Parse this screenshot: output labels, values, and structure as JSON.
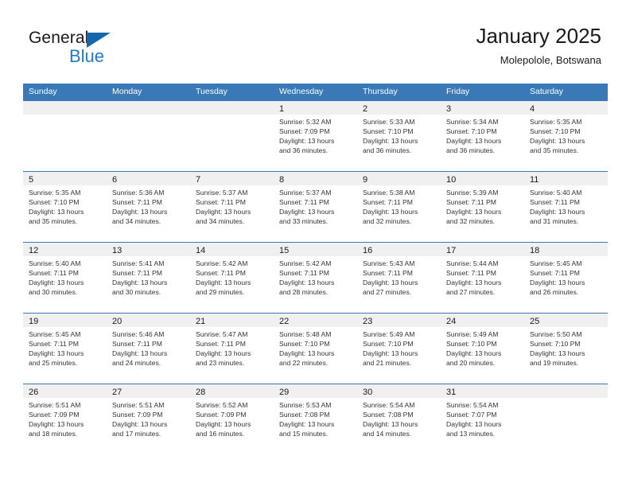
{
  "brand": {
    "word_one": "General",
    "word_two": "Blue",
    "triangle_icon": "triangle-logo-icon",
    "accent_color": "#1f7cc4",
    "triangle_color": "#1666ad"
  },
  "header": {
    "title": "January 2025",
    "subtitle": "Molepolole, Botswana"
  },
  "theme": {
    "header_row_bg": "#3a79b8",
    "day_band_bg": "#f0f0f0",
    "row_divider": "#3a79b8",
    "text": "#333333"
  },
  "weekdays": [
    "Sunday",
    "Monday",
    "Tuesday",
    "Wednesday",
    "Thursday",
    "Friday",
    "Saturday"
  ],
  "weeks": [
    [
      {
        "day": "",
        "lines": []
      },
      {
        "day": "",
        "lines": []
      },
      {
        "day": "",
        "lines": []
      },
      {
        "day": "1",
        "lines": [
          "Sunrise: 5:32 AM",
          "Sunset: 7:09 PM",
          "Daylight: 13 hours",
          "and 36 minutes."
        ]
      },
      {
        "day": "2",
        "lines": [
          "Sunrise: 5:33 AM",
          "Sunset: 7:10 PM",
          "Daylight: 13 hours",
          "and 36 minutes."
        ]
      },
      {
        "day": "3",
        "lines": [
          "Sunrise: 5:34 AM",
          "Sunset: 7:10 PM",
          "Daylight: 13 hours",
          "and 36 minutes."
        ]
      },
      {
        "day": "4",
        "lines": [
          "Sunrise: 5:35 AM",
          "Sunset: 7:10 PM",
          "Daylight: 13 hours",
          "and 35 minutes."
        ]
      }
    ],
    [
      {
        "day": "5",
        "lines": [
          "Sunrise: 5:35 AM",
          "Sunset: 7:10 PM",
          "Daylight: 13 hours",
          "and 35 minutes."
        ]
      },
      {
        "day": "6",
        "lines": [
          "Sunrise: 5:36 AM",
          "Sunset: 7:11 PM",
          "Daylight: 13 hours",
          "and 34 minutes."
        ]
      },
      {
        "day": "7",
        "lines": [
          "Sunrise: 5:37 AM",
          "Sunset: 7:11 PM",
          "Daylight: 13 hours",
          "and 34 minutes."
        ]
      },
      {
        "day": "8",
        "lines": [
          "Sunrise: 5:37 AM",
          "Sunset: 7:11 PM",
          "Daylight: 13 hours",
          "and 33 minutes."
        ]
      },
      {
        "day": "9",
        "lines": [
          "Sunrise: 5:38 AM",
          "Sunset: 7:11 PM",
          "Daylight: 13 hours",
          "and 32 minutes."
        ]
      },
      {
        "day": "10",
        "lines": [
          "Sunrise: 5:39 AM",
          "Sunset: 7:11 PM",
          "Daylight: 13 hours",
          "and 32 minutes."
        ]
      },
      {
        "day": "11",
        "lines": [
          "Sunrise: 5:40 AM",
          "Sunset: 7:11 PM",
          "Daylight: 13 hours",
          "and 31 minutes."
        ]
      }
    ],
    [
      {
        "day": "12",
        "lines": [
          "Sunrise: 5:40 AM",
          "Sunset: 7:11 PM",
          "Daylight: 13 hours",
          "and 30 minutes."
        ]
      },
      {
        "day": "13",
        "lines": [
          "Sunrise: 5:41 AM",
          "Sunset: 7:11 PM",
          "Daylight: 13 hours",
          "and 30 minutes."
        ]
      },
      {
        "day": "14",
        "lines": [
          "Sunrise: 5:42 AM",
          "Sunset: 7:11 PM",
          "Daylight: 13 hours",
          "and 29 minutes."
        ]
      },
      {
        "day": "15",
        "lines": [
          "Sunrise: 5:42 AM",
          "Sunset: 7:11 PM",
          "Daylight: 13 hours",
          "and 28 minutes."
        ]
      },
      {
        "day": "16",
        "lines": [
          "Sunrise: 5:43 AM",
          "Sunset: 7:11 PM",
          "Daylight: 13 hours",
          "and 27 minutes."
        ]
      },
      {
        "day": "17",
        "lines": [
          "Sunrise: 5:44 AM",
          "Sunset: 7:11 PM",
          "Daylight: 13 hours",
          "and 27 minutes."
        ]
      },
      {
        "day": "18",
        "lines": [
          "Sunrise: 5:45 AM",
          "Sunset: 7:11 PM",
          "Daylight: 13 hours",
          "and 26 minutes."
        ]
      }
    ],
    [
      {
        "day": "19",
        "lines": [
          "Sunrise: 5:45 AM",
          "Sunset: 7:11 PM",
          "Daylight: 13 hours",
          "and 25 minutes."
        ]
      },
      {
        "day": "20",
        "lines": [
          "Sunrise: 5:46 AM",
          "Sunset: 7:11 PM",
          "Daylight: 13 hours",
          "and 24 minutes."
        ]
      },
      {
        "day": "21",
        "lines": [
          "Sunrise: 5:47 AM",
          "Sunset: 7:11 PM",
          "Daylight: 13 hours",
          "and 23 minutes."
        ]
      },
      {
        "day": "22",
        "lines": [
          "Sunrise: 5:48 AM",
          "Sunset: 7:10 PM",
          "Daylight: 13 hours",
          "and 22 minutes."
        ]
      },
      {
        "day": "23",
        "lines": [
          "Sunrise: 5:49 AM",
          "Sunset: 7:10 PM",
          "Daylight: 13 hours",
          "and 21 minutes."
        ]
      },
      {
        "day": "24",
        "lines": [
          "Sunrise: 5:49 AM",
          "Sunset: 7:10 PM",
          "Daylight: 13 hours",
          "and 20 minutes."
        ]
      },
      {
        "day": "25",
        "lines": [
          "Sunrise: 5:50 AM",
          "Sunset: 7:10 PM",
          "Daylight: 13 hours",
          "and 19 minutes."
        ]
      }
    ],
    [
      {
        "day": "26",
        "lines": [
          "Sunrise: 5:51 AM",
          "Sunset: 7:09 PM",
          "Daylight: 13 hours",
          "and 18 minutes."
        ]
      },
      {
        "day": "27",
        "lines": [
          "Sunrise: 5:51 AM",
          "Sunset: 7:09 PM",
          "Daylight: 13 hours",
          "and 17 minutes."
        ]
      },
      {
        "day": "28",
        "lines": [
          "Sunrise: 5:52 AM",
          "Sunset: 7:09 PM",
          "Daylight: 13 hours",
          "and 16 minutes."
        ]
      },
      {
        "day": "29",
        "lines": [
          "Sunrise: 5:53 AM",
          "Sunset: 7:08 PM",
          "Daylight: 13 hours",
          "and 15 minutes."
        ]
      },
      {
        "day": "30",
        "lines": [
          "Sunrise: 5:54 AM",
          "Sunset: 7:08 PM",
          "Daylight: 13 hours",
          "and 14 minutes."
        ]
      },
      {
        "day": "31",
        "lines": [
          "Sunrise: 5:54 AM",
          "Sunset: 7:07 PM",
          "Daylight: 13 hours",
          "and 13 minutes."
        ]
      },
      {
        "day": "",
        "lines": []
      }
    ]
  ]
}
